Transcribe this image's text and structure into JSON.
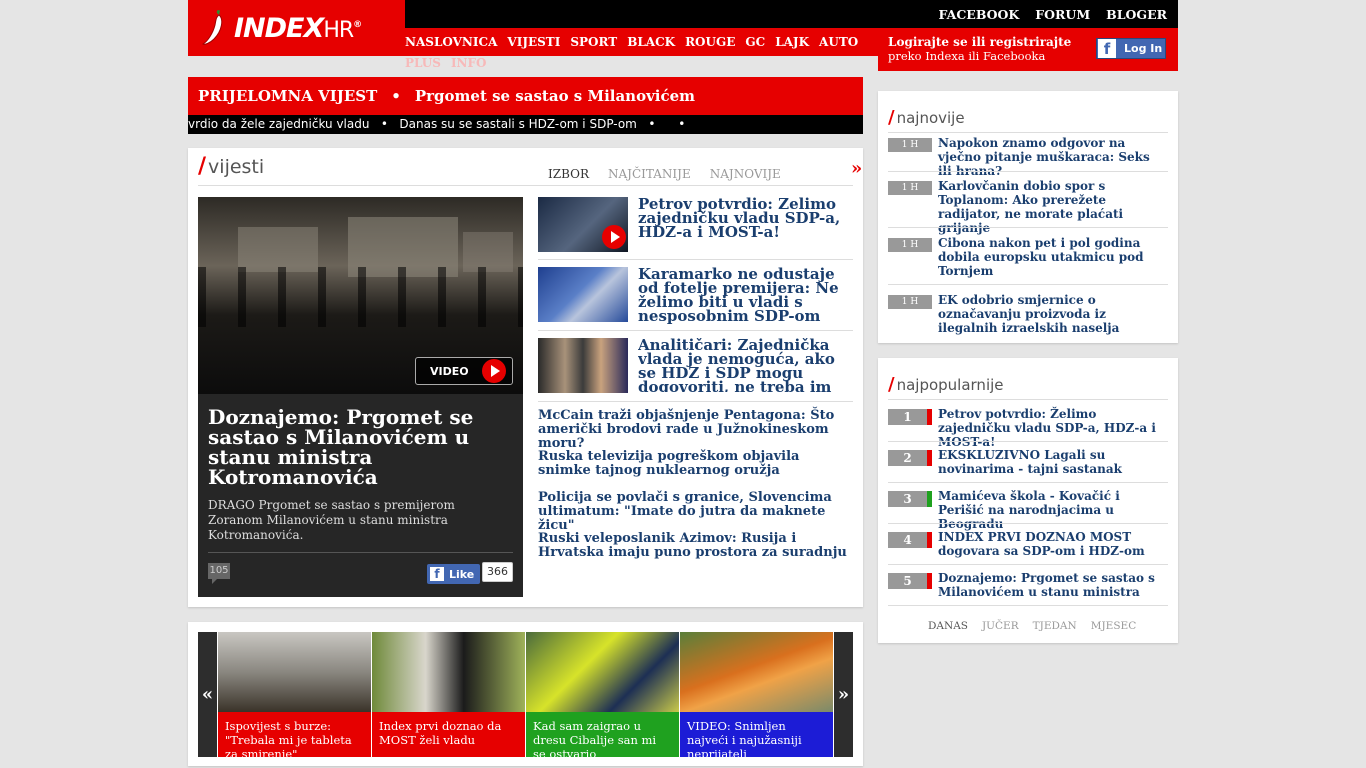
{
  "header": {
    "logo_text": "INDEX",
    "logo_suffix": "HR",
    "registered": "®",
    "top_links": [
      "FACEBOOK",
      "FORUM",
      "BLOGER"
    ],
    "nav": [
      "NASLOVNICA",
      "VIJESTI",
      "SPORT",
      "BLACK",
      "ROUGE",
      "GC",
      "LAJK",
      "AUTO",
      "PLUS",
      "INFO"
    ],
    "login_line1": "Logirajte se ili registrirajte",
    "login_line2": "preko Indexa ili Facebooka",
    "login_button": "Log In",
    "fb_letter": "f"
  },
  "breaking": {
    "label": "PRIJELOMNA VIJEST",
    "bullet": "•",
    "headline": "Prgomet se sastao s Milanovićem"
  },
  "ticker": {
    "text": "vrdio da žele zajedničku vladu   •   Danas su se sastali s HDZ-om i SDP-om   •      •"
  },
  "vijesti": {
    "title": "vijesti",
    "slash": "/",
    "tabs": [
      "IZBOR",
      "NAJČITANIJE",
      "NAJNOVIJE"
    ],
    "more": "»",
    "hero": {
      "video_label": "VIDEO",
      "headline": "Doznajemo: Prgomet se sastao s Milanovićem u stanu ministra Kotromanovića",
      "lead": "DRAGO Prgomet se sastao s premijerom Zoranom Milanovićem u stanu ministra Kotromanovića.",
      "comments": "105",
      "like_label": "Like",
      "like_count": "366"
    },
    "stories": [
      {
        "title": "Petrov potvrdio: Želimo zajedničku vladu SDP-a, HDZ-a i MOST-a!"
      },
      {
        "title": "Karamarko ne odustaje od fotelje premijera: Ne želimo biti u vladi s nesposobnim SDP-om"
      },
      {
        "title": "Analitičari: Zajednička vlada je nemoguća, ako se HDZ i SDP mogu dogovoriti, ne treba im MOST"
      }
    ],
    "short_stories": [
      "McCain traži objašnjenje Pentagona: Što američki brodovi rade u Južnokineskom moru?",
      "Ruska televizija pogreškom objavila snimke tajnog nuklearnog oružja",
      "Policija se povlači s granice, Slovencima ultimatum: \"Imate do jutra da maknete žicu\"",
      "Ruski veleposlanik Azimov: Rusija i Hrvatska imaju puno prostora za suradnju"
    ]
  },
  "carousel": {
    "prev": "«",
    "next": "»",
    "items": [
      {
        "caption": "Ispovijest s burze: \"Trebala mi je tableta za smirenje\"",
        "color": "#e60000"
      },
      {
        "caption": "Index prvi doznao da MOST želi vladu",
        "color": "#e60000"
      },
      {
        "caption": "Kad sam zaigrao u dresu Cibalije san mi se ostvario",
        "color": "#1fa11f"
      },
      {
        "caption": "VIDEO: Snimljen najveći i najužasniji neprijatelj",
        "color": "#1c1cd6"
      }
    ]
  },
  "najnovije": {
    "title": "najnovije",
    "slash": "/",
    "items": [
      {
        "time": "1 H",
        "title": "Napokon znamo odgovor na vječno pitanje muškaraca: Seks ili hrana?"
      },
      {
        "time": "1 H",
        "title": "Karlovčanin dobio spor s Toplanom: Ako prerežete radijator, ne morate plaćati grijanje"
      },
      {
        "time": "1 H",
        "title": "Cibona nakon pet i pol godina dobila europsku utakmicu pod Tornjem"
      },
      {
        "time": "1 H",
        "title": "EK odobrio smjernice o označavanju proizvoda iz ilegalnih izraelskih naselja"
      }
    ]
  },
  "najpopularnije": {
    "title": "najpopularnije",
    "slash": "/",
    "items": [
      {
        "num": "1",
        "title": "Petrov potvrdio: Želimo zajedničku vladu SDP-a, HDZ-a i MOST-a!",
        "color": "#e60000"
      },
      {
        "num": "2",
        "title": "EKSKLUZIVNO Lagali su novinarima - tajni sastanak",
        "color": "#e60000"
      },
      {
        "num": "3",
        "title": "Mamićeva škola - Kovačić i Perišić na narodnjacima u Beogradu",
        "color": "#1fa11f"
      },
      {
        "num": "4",
        "title": "INDEX PRVI DOZNAO MOST dogovara sa SDP-om i HDZ-om",
        "color": "#e60000"
      },
      {
        "num": "5",
        "title": "Doznajemo: Prgomet se sastao s Milanovićem u stanu ministra",
        "color": "#e60000"
      }
    ],
    "tabs": [
      "DANAS",
      "JUČER",
      "TJEDAN",
      "MJESEC"
    ]
  }
}
